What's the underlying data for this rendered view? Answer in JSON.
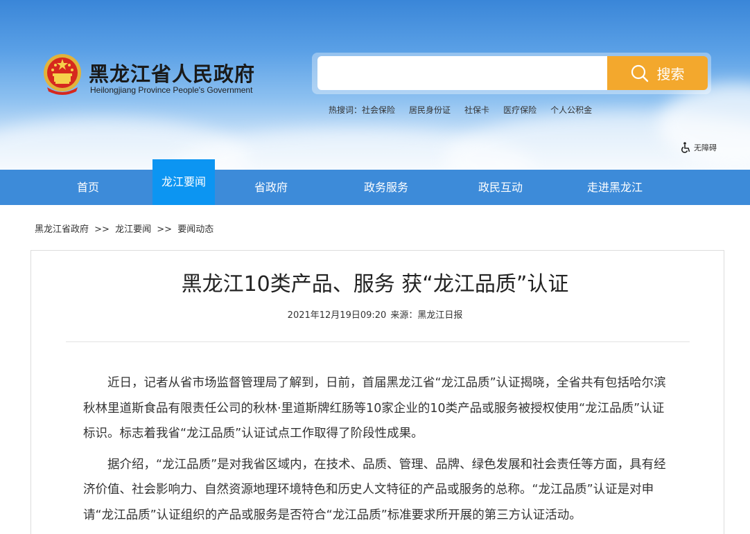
{
  "header": {
    "site_title": "黑龙江省人民政府",
    "site_subtitle": "Heilongjiang Province People's Government",
    "search_placeholder": "",
    "search_button": "搜索",
    "hot_label": "热搜词：",
    "hot_words": [
      "社会保险",
      "居民身份证",
      "社保卡",
      "医疗保险",
      "个人公积金"
    ],
    "accessibility": "无障碍"
  },
  "nav": {
    "items": [
      "首页",
      "龙江要闻",
      "省政府",
      "政务服务",
      "政民互动",
      "走进黑龙江"
    ],
    "active_index": 1
  },
  "breadcrumb": [
    "黑龙江省政府",
    ">>",
    "龙江要闻",
    ">>",
    "要闻动态"
  ],
  "article": {
    "title": "黑龙江10类产品、服务 获“龙江品质”认证",
    "date": "2021年12月19日09:20",
    "source": "来源：黑龙江日报",
    "paragraphs": [
      "近日，记者从省市场监督管理局了解到，日前，首届黑龙江省“龙江品质”认证揭晓，全省共有包括哈尔滨秋林里道斯食品有限责任公司的秋林·里道斯牌红肠等10家企业的10类产品或服务被授权使用“龙江品质”认证标识。标志着我省“龙江品质”认证试点工作取得了阶段性成果。",
      "据介绍，“龙江品质”是对我省区域内，在技术、品质、管理、品牌、绿色发展和社会责任等方面，具有经济价值、社会影响力、自然资源地理环境特色和历史人文特征的产品或服务的总称。“龙江品质”认证是对申请“龙江品质”认证组织的产品或服务是否符合“龙江品质”标准要求所开展的第三方认证活动。"
    ]
  },
  "colors": {
    "nav_bg": "#3d8bd9",
    "nav_active": "#0c95f2",
    "search_button": "#f3a82d"
  }
}
